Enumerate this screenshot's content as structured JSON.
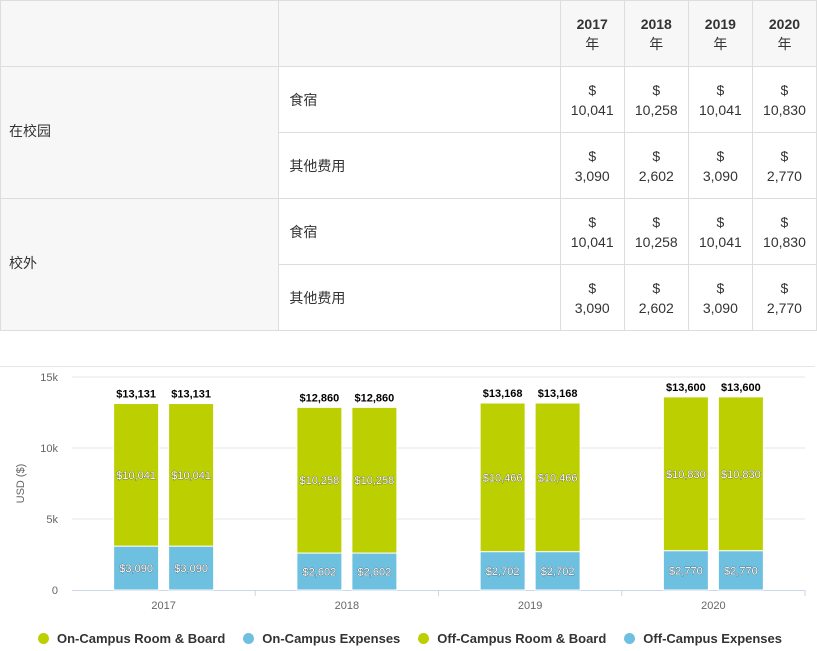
{
  "table": {
    "years": [
      {
        "year": "2017",
        "suffix": "年"
      },
      {
        "year": "2018",
        "suffix": "年"
      },
      {
        "year": "2019",
        "suffix": "年"
      },
      {
        "year": "2020",
        "suffix": "年"
      }
    ],
    "groups": [
      {
        "label": "在校园",
        "rows": [
          {
            "label": "食宿",
            "values": [
              {
                "cur": "$",
                "amt": "10,041"
              },
              {
                "cur": "$",
                "amt": "10,258"
              },
              {
                "cur": "$",
                "amt": "10,041"
              },
              {
                "cur": "$",
                "amt": "10,830"
              }
            ]
          },
          {
            "label": "其他费用",
            "values": [
              {
                "cur": "$",
                "amt": "3,090"
              },
              {
                "cur": "$",
                "amt": "2,602"
              },
              {
                "cur": "$",
                "amt": "3,090"
              },
              {
                "cur": "$",
                "amt": "2,770"
              }
            ]
          }
        ]
      },
      {
        "label": "校外",
        "rows": [
          {
            "label": "食宿",
            "values": [
              {
                "cur": "$",
                "amt": "10,041"
              },
              {
                "cur": "$",
                "amt": "10,258"
              },
              {
                "cur": "$",
                "amt": "10,041"
              },
              {
                "cur": "$",
                "amt": "10,830"
              }
            ]
          },
          {
            "label": "其他费用",
            "values": [
              {
                "cur": "$",
                "amt": "3,090"
              },
              {
                "cur": "$",
                "amt": "2,602"
              },
              {
                "cur": "$",
                "amt": "3,090"
              },
              {
                "cur": "$",
                "amt": "2,770"
              }
            ]
          }
        ]
      }
    ]
  },
  "chart_data": {
    "type": "bar",
    "stacked": true,
    "categories": [
      "2017",
      "2018",
      "2019",
      "2020"
    ],
    "ylabel": "USD ($)",
    "ylim": [
      0,
      15000
    ],
    "yticks": [
      {
        "value": 0,
        "label": "0"
      },
      {
        "value": 5000,
        "label": "5k"
      },
      {
        "value": 10000,
        "label": "10k"
      },
      {
        "value": 15000,
        "label": "15k"
      }
    ],
    "grid": true,
    "legend_position": "bottom",
    "stacks": [
      {
        "stack": "on-campus",
        "series": [
          {
            "name": "On-Campus Expenses",
            "color": "#6ec0e0",
            "values": [
              3090,
              2602,
              2702,
              2770
            ],
            "labels": [
              "$3,090",
              "$2,602",
              "$2,702",
              "$2,770"
            ]
          },
          {
            "name": "On-Campus Room & Board",
            "color": "#bccf00",
            "values": [
              10041,
              10258,
              10466,
              10830
            ],
            "labels": [
              "$10,041",
              "$10,258",
              "$10,466",
              "$10,830"
            ]
          }
        ],
        "totals": [
          "$13,131",
          "$12,860",
          "$13,168",
          "$13,600"
        ]
      },
      {
        "stack": "off-campus",
        "series": [
          {
            "name": "Off-Campus Expenses",
            "color": "#6ec0e0",
            "values": [
              3090,
              2602,
              2702,
              2770
            ],
            "labels": [
              "$3,090",
              "$2,602",
              "$2,702",
              "$2,770"
            ]
          },
          {
            "name": "Off-Campus Room & Board",
            "color": "#bccf00",
            "values": [
              10041,
              10258,
              10466,
              10830
            ],
            "labels": [
              "$10,041",
              "$10,258",
              "$10,466",
              "$10,830"
            ]
          }
        ],
        "totals": [
          "$13,131",
          "$12,860",
          "$13,168",
          "$13,600"
        ]
      }
    ],
    "legend": [
      {
        "name": "On-Campus Room & Board",
        "color": "#bccf00"
      },
      {
        "name": "On-Campus Expenses",
        "color": "#6ec0e0"
      },
      {
        "name": "Off-Campus Room & Board",
        "color": "#bccf00"
      },
      {
        "name": "Off-Campus Expenses",
        "color": "#6ec0e0"
      }
    ]
  }
}
